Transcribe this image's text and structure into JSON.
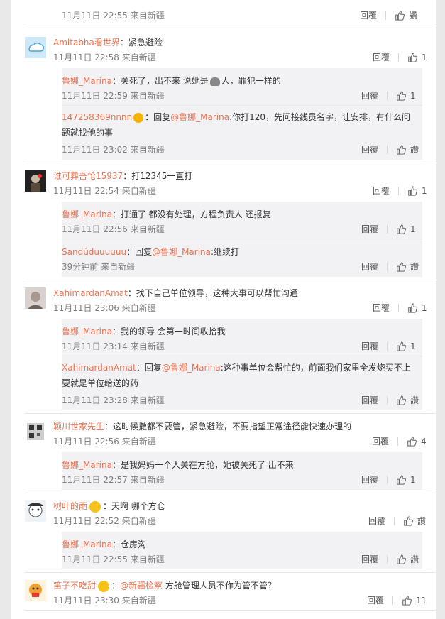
{
  "labels": {
    "reply": "回覆"
  },
  "comments": [
    {
      "time": "11月11日 22:55",
      "loc": "来自新疆",
      "like": "讚"
    },
    {
      "user": "Amitabha看世界",
      "text": "：紧急避险",
      "time": "11月11日 22:58",
      "loc": "来自新疆",
      "like": "1",
      "replies": [
        {
          "user": "鲁娜_Marina",
          "text": "：关死了，出不来 说她是",
          "text2": "人，罪犯一样的",
          "time": "11月11日 22:59",
          "loc": "来自新疆",
          "like": "1"
        },
        {
          "user": "147258369nnnn",
          "text": "：回复",
          "mention": "@鲁娜_Marina",
          "text2": ":你打120，先问接线员名字，让安排，有什么问题就找他的事",
          "time": "11月11日 23:02",
          "loc": "来自新疆",
          "like": "讚"
        }
      ]
    },
    {
      "user": "谁可葬吾怆15937",
      "text": "：打12345一直打",
      "time": "11月11日 22:54",
      "loc": "来自新疆",
      "like": "1",
      "replies": [
        {
          "user": "鲁娜_Marina",
          "text": "：打通了 都没有处理，方程负责人 还报复",
          "time": "11月11日 22:56",
          "loc": "来自新疆",
          "like": "1"
        },
        {
          "user": "Sandúduuuuuu",
          "text": "：回复",
          "mention": "@鲁娜_Marina",
          "text2": ":继续打",
          "time": "39分钟前",
          "loc": "来自新疆",
          "like": "讚"
        }
      ]
    },
    {
      "user": "XahimardanAmat",
      "text": "：找下自己单位领导，这种大事可以帮忙沟通",
      "time": "11月11日 23:06",
      "loc": "来自新疆",
      "like": "1",
      "replies": [
        {
          "user": "鲁娜_Marina",
          "text": "：我的领导 会第一时间收拾我",
          "time": "11月11日 23:14",
          "loc": "来自新疆",
          "like": "1"
        },
        {
          "user": "XahimardanAmat",
          "text": "：回复",
          "mention": "@鲁娜_Marina",
          "text2": ":这种事单位会帮忙的，前面我们家里全发烧买不上要就是单位给送的药",
          "time": "11月11日 23:28",
          "loc": "来自新疆",
          "like": "讚"
        }
      ]
    },
    {
      "user": "颍川世家先生",
      "text": "：这时候撒都不要管，紧急避险，不要指望正常途径能快速办理的",
      "time": "11月11日 22:56",
      "loc": "来自新疆",
      "like": "4",
      "replies": [
        {
          "user": "鲁娜_Marina",
          "text": "：是我妈妈一个人关在方舱，她被关死了 出不来",
          "time": "11月11日 22:57",
          "loc": "来自新疆",
          "like": "1"
        }
      ]
    },
    {
      "user": "树叶的雨",
      "text": "：天啊 哪个方仓",
      "time": "11月11日 22:52",
      "loc": "来自新疆",
      "like": "讚",
      "replies": [
        {
          "user": "鲁娜_Marina",
          "text": "：仓房沟",
          "time": "11月11日 22:55",
          "loc": "来自新疆",
          "like": "讚"
        }
      ]
    },
    {
      "user": "笛子不吃甜",
      "text": "：",
      "mention": "@新疆检察",
      "text2": " 方舱管理人员不作为管不管？",
      "time": "11月11日 23:30",
      "loc": "来自新疆",
      "like": "11"
    }
  ]
}
